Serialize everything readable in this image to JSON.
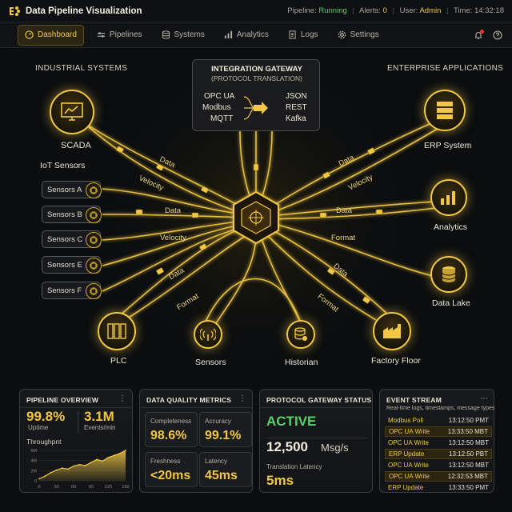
{
  "app": {
    "title": "Data Pipeline Visualization",
    "status": {
      "pipeline_label": "Pipeline:",
      "pipeline_value": "Running",
      "alerts_label": "Alerts:",
      "alerts_value": "0",
      "user_label": "User:",
      "user_value": "Admin",
      "time_label": "Time:",
      "time_value": "14:32:18"
    }
  },
  "nav": {
    "items": [
      {
        "label": "Dashboard",
        "icon": "dashboard-icon"
      },
      {
        "label": "Pipelines",
        "icon": "pipelines-icon"
      },
      {
        "label": "Systems",
        "icon": "systems-icon"
      },
      {
        "label": "Analytics",
        "icon": "analytics-icon"
      },
      {
        "label": "Logs",
        "icon": "logs-icon"
      },
      {
        "label": "Settings",
        "icon": "settings-icon"
      }
    ],
    "active": "Dashboard"
  },
  "diagram": {
    "left_header": "INDUSTRIAL SYSTEMS",
    "right_header": "ENTERPRISE APPLICATIONS",
    "gateway": {
      "title": "INTEGRATION GATEWAY",
      "subtitle": "(PROTOCOL TRANSLATION)",
      "inputs": [
        "OPC UA",
        "Modbus",
        "MQTT"
      ],
      "outputs": [
        "JSON",
        "REST",
        "Kafka"
      ]
    },
    "left_nodes": {
      "scada": "SCADA",
      "iot": "IoT Sensors",
      "plc": "PLC"
    },
    "sensors": [
      "Sensors A",
      "Sensors B",
      "Sensors C",
      "Sensors E",
      "Sensors F"
    ],
    "bottom_nodes": {
      "sensors": "Sensors",
      "historian": "Historian",
      "factory": "Factory Floor"
    },
    "right_nodes": {
      "erp": "ERP System",
      "analytics": "Analytics",
      "lake": "Data Lake"
    },
    "flow_labels": {
      "data": "Data",
      "velocity": "Velocity",
      "format": "Format"
    }
  },
  "panels": {
    "overview": {
      "title": "PIPELINE OVERVIEW",
      "uptime_value": "99.8%",
      "uptime_label": "Uptime",
      "events_value": "3.1M",
      "events_label": "Events/min",
      "chart_label": "Throughpnt",
      "chart_data": {
        "type": "area",
        "x": [
          0,
          10,
          20,
          30,
          40,
          50,
          60,
          70,
          80,
          90,
          100,
          110,
          120,
          130,
          140,
          150
        ],
        "values": [
          0.4,
          0.9,
          1.6,
          2.1,
          2.5,
          2.3,
          2.9,
          3.2,
          3.0,
          3.6,
          4.2,
          3.9,
          4.6,
          5.0,
          5.4,
          6.0
        ],
        "x_ticks": [
          "0",
          "30",
          "60",
          "90",
          "120",
          "150"
        ],
        "y_ticks": [
          "0",
          "2M",
          "4M",
          "6M"
        ],
        "ylim": [
          0,
          6
        ]
      }
    },
    "quality": {
      "title": "DATA QUALITY METRICS",
      "metrics": [
        {
          "label": "Completeness",
          "value": "98.6%"
        },
        {
          "label": "Accuracy",
          "value": "99.1%"
        },
        {
          "label": "Freshness",
          "value": "<20ms"
        },
        {
          "label": "Latency",
          "value": "45ms"
        }
      ]
    },
    "gateway_status": {
      "title": "PROTOCOL GATEWAY STATUS",
      "status": "ACTIVE",
      "rate_value": "12,500",
      "rate_unit": "Msg/s",
      "latency_label": "Translation Latency",
      "latency_value": "5ms"
    },
    "events": {
      "title": "EVENT STREAM",
      "subtitle": "Real-time logs, timestamps, message types",
      "rows": [
        {
          "name": "Modbus Poll",
          "time": "13:12:50 PMT"
        },
        {
          "name": "OPC UA Write",
          "time": "13:33:50 MBT"
        },
        {
          "name": "OPC UA Write",
          "time": "13:12:50 MBT"
        },
        {
          "name": "ERP Update",
          "time": "13:12:50 PBT"
        },
        {
          "name": "OPC UA Write",
          "time": "13:12:50 MBT"
        },
        {
          "name": "OPC UA Write",
          "time": "12:32:53 MBT"
        },
        {
          "name": "ERP Update",
          "time": "13:33:50 PMT"
        }
      ]
    }
  },
  "colors": {
    "accent": "#f2c744",
    "running": "#55d36a",
    "background": "#0b0d0f"
  }
}
